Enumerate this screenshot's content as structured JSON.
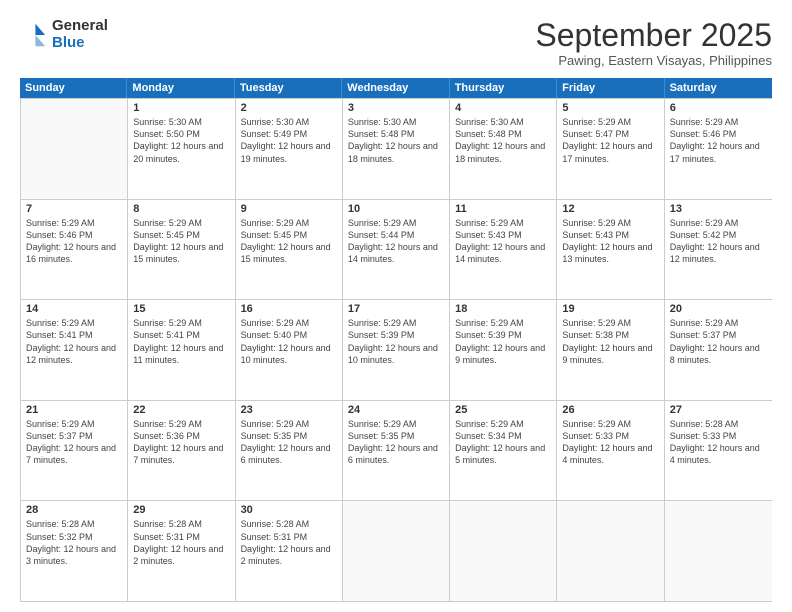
{
  "logo": {
    "general": "General",
    "blue": "Blue"
  },
  "title": "September 2025",
  "location": "Pawing, Eastern Visayas, Philippines",
  "days": [
    "Sunday",
    "Monday",
    "Tuesday",
    "Wednesday",
    "Thursday",
    "Friday",
    "Saturday"
  ],
  "weeks": [
    [
      {
        "day": "",
        "empty": true
      },
      {
        "day": "1",
        "sunrise": "5:30 AM",
        "sunset": "5:50 PM",
        "daylight": "12 hours and 20 minutes."
      },
      {
        "day": "2",
        "sunrise": "5:30 AM",
        "sunset": "5:49 PM",
        "daylight": "12 hours and 19 minutes."
      },
      {
        "day": "3",
        "sunrise": "5:30 AM",
        "sunset": "5:48 PM",
        "daylight": "12 hours and 18 minutes."
      },
      {
        "day": "4",
        "sunrise": "5:30 AM",
        "sunset": "5:48 PM",
        "daylight": "12 hours and 18 minutes."
      },
      {
        "day": "5",
        "sunrise": "5:29 AM",
        "sunset": "5:47 PM",
        "daylight": "12 hours and 17 minutes."
      },
      {
        "day": "6",
        "sunrise": "5:29 AM",
        "sunset": "5:46 PM",
        "daylight": "12 hours and 17 minutes."
      }
    ],
    [
      {
        "day": "7",
        "sunrise": "5:29 AM",
        "sunset": "5:46 PM",
        "daylight": "12 hours and 16 minutes."
      },
      {
        "day": "8",
        "sunrise": "5:29 AM",
        "sunset": "5:45 PM",
        "daylight": "12 hours and 15 minutes."
      },
      {
        "day": "9",
        "sunrise": "5:29 AM",
        "sunset": "5:45 PM",
        "daylight": "12 hours and 15 minutes."
      },
      {
        "day": "10",
        "sunrise": "5:29 AM",
        "sunset": "5:44 PM",
        "daylight": "12 hours and 14 minutes."
      },
      {
        "day": "11",
        "sunrise": "5:29 AM",
        "sunset": "5:43 PM",
        "daylight": "12 hours and 14 minutes."
      },
      {
        "day": "12",
        "sunrise": "5:29 AM",
        "sunset": "5:43 PM",
        "daylight": "12 hours and 13 minutes."
      },
      {
        "day": "13",
        "sunrise": "5:29 AM",
        "sunset": "5:42 PM",
        "daylight": "12 hours and 12 minutes."
      }
    ],
    [
      {
        "day": "14",
        "sunrise": "5:29 AM",
        "sunset": "5:41 PM",
        "daylight": "12 hours and 12 minutes."
      },
      {
        "day": "15",
        "sunrise": "5:29 AM",
        "sunset": "5:41 PM",
        "daylight": "12 hours and 11 minutes."
      },
      {
        "day": "16",
        "sunrise": "5:29 AM",
        "sunset": "5:40 PM",
        "daylight": "12 hours and 10 minutes."
      },
      {
        "day": "17",
        "sunrise": "5:29 AM",
        "sunset": "5:39 PM",
        "daylight": "12 hours and 10 minutes."
      },
      {
        "day": "18",
        "sunrise": "5:29 AM",
        "sunset": "5:39 PM",
        "daylight": "12 hours and 9 minutes."
      },
      {
        "day": "19",
        "sunrise": "5:29 AM",
        "sunset": "5:38 PM",
        "daylight": "12 hours and 9 minutes."
      },
      {
        "day": "20",
        "sunrise": "5:29 AM",
        "sunset": "5:37 PM",
        "daylight": "12 hours and 8 minutes."
      }
    ],
    [
      {
        "day": "21",
        "sunrise": "5:29 AM",
        "sunset": "5:37 PM",
        "daylight": "12 hours and 7 minutes."
      },
      {
        "day": "22",
        "sunrise": "5:29 AM",
        "sunset": "5:36 PM",
        "daylight": "12 hours and 7 minutes."
      },
      {
        "day": "23",
        "sunrise": "5:29 AM",
        "sunset": "5:35 PM",
        "daylight": "12 hours and 6 minutes."
      },
      {
        "day": "24",
        "sunrise": "5:29 AM",
        "sunset": "5:35 PM",
        "daylight": "12 hours and 6 minutes."
      },
      {
        "day": "25",
        "sunrise": "5:29 AM",
        "sunset": "5:34 PM",
        "daylight": "12 hours and 5 minutes."
      },
      {
        "day": "26",
        "sunrise": "5:29 AM",
        "sunset": "5:33 PM",
        "daylight": "12 hours and 4 minutes."
      },
      {
        "day": "27",
        "sunrise": "5:28 AM",
        "sunset": "5:33 PM",
        "daylight": "12 hours and 4 minutes."
      }
    ],
    [
      {
        "day": "28",
        "sunrise": "5:28 AM",
        "sunset": "5:32 PM",
        "daylight": "12 hours and 3 minutes."
      },
      {
        "day": "29",
        "sunrise": "5:28 AM",
        "sunset": "5:31 PM",
        "daylight": "12 hours and 2 minutes."
      },
      {
        "day": "30",
        "sunrise": "5:28 AM",
        "sunset": "5:31 PM",
        "daylight": "12 hours and 2 minutes."
      },
      {
        "day": "",
        "empty": true
      },
      {
        "day": "",
        "empty": true
      },
      {
        "day": "",
        "empty": true
      },
      {
        "day": "",
        "empty": true
      }
    ]
  ]
}
